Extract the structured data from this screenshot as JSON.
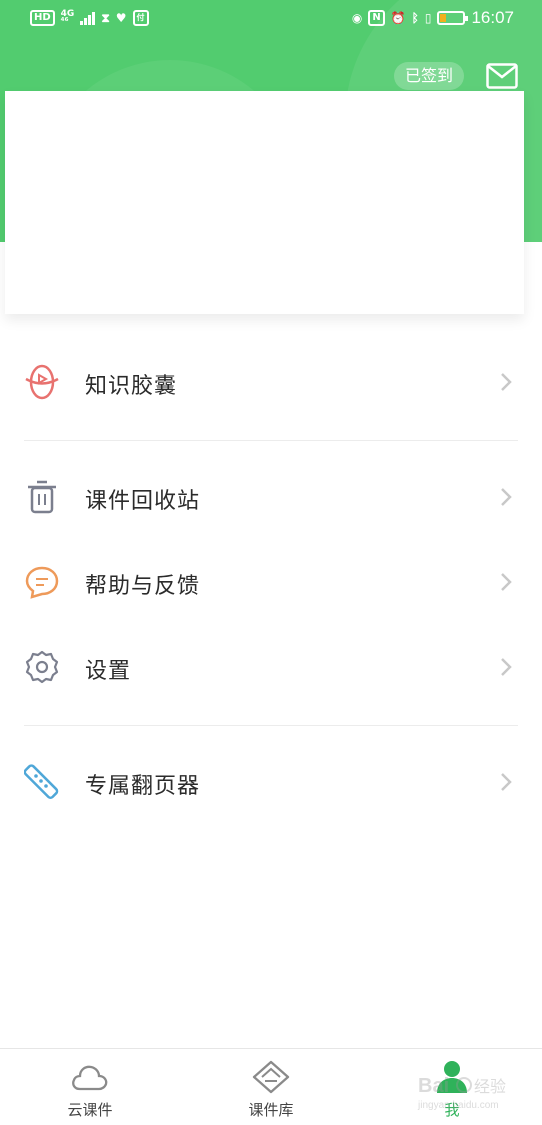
{
  "status_bar": {
    "left_icons": [
      "HD",
      "4G",
      "signal-icon",
      "hourglass-icon",
      "heart-monitor-icon",
      "pay-icon"
    ],
    "right_icons": [
      "eye-icon",
      "nfc-icon",
      "alarm-icon",
      "bluetooth-icon",
      "vibrate-icon",
      "battery-icon"
    ],
    "time": "16:07"
  },
  "header": {
    "signin_label": "已签到",
    "mail_icon": "mail-icon",
    "accent_color": "#52cc6f"
  },
  "menu": {
    "items": [
      {
        "label": "知识胶囊",
        "icon": "capsule-play-icon",
        "icon_color": "#e8726f"
      },
      {
        "label": "课件回收站",
        "icon": "trash-icon",
        "icon_color": "#7b7f8e"
      },
      {
        "label": "帮助与反馈",
        "icon": "chat-bubble-icon",
        "icon_color": "#ee9a5a"
      },
      {
        "label": "设置",
        "icon": "gear-icon",
        "icon_color": "#7b7f8e"
      },
      {
        "label": "专属翻页器",
        "icon": "remote-control-icon",
        "icon_color": "#4fa7d8"
      }
    ]
  },
  "tab_bar": {
    "tabs": [
      {
        "label": "云课件",
        "icon": "cloud-icon",
        "active": false
      },
      {
        "label": "课件库",
        "icon": "diamond-library-icon",
        "active": false
      },
      {
        "label": "我",
        "icon": "person-icon",
        "active": true
      }
    ],
    "active_color": "#2fb25a"
  }
}
